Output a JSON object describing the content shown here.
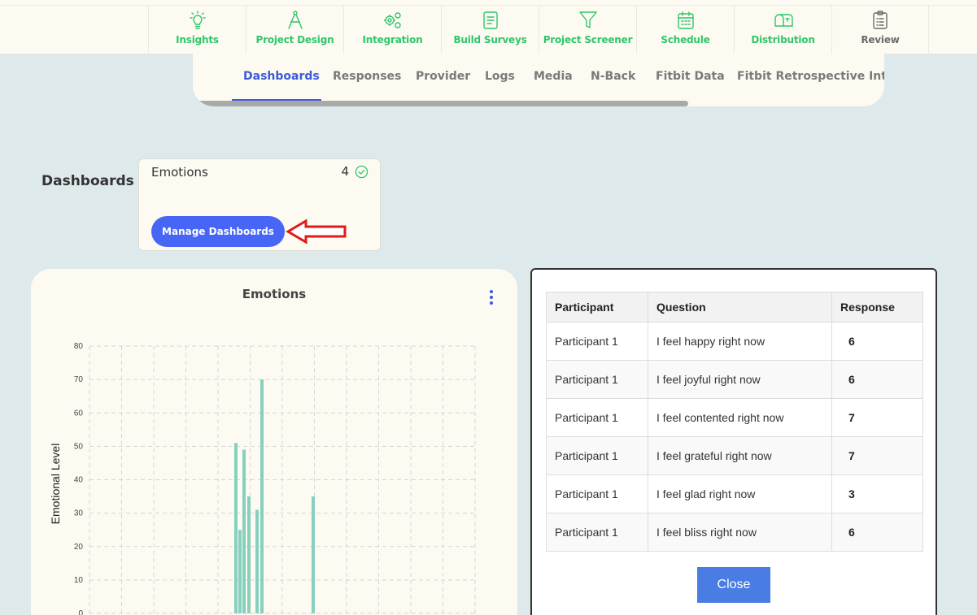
{
  "topnav": {
    "items": [
      {
        "label": "Insights",
        "icon": "lightbulb-icon"
      },
      {
        "label": "Project Design",
        "icon": "compass-icon"
      },
      {
        "label": "Integration",
        "icon": "gears-icon"
      },
      {
        "label": "Build Surveys",
        "icon": "document-icon"
      },
      {
        "label": "Project Screener",
        "icon": "filter-icon"
      },
      {
        "label": "Schedule",
        "icon": "calendar-icon"
      },
      {
        "label": "Distribution",
        "icon": "mailbox-icon"
      },
      {
        "label": "Review",
        "icon": "clipboard-icon"
      }
    ],
    "accent": "#2fc66a"
  },
  "subtabs": {
    "items": [
      "Dashboards",
      "Responses",
      "Provider",
      "Logs",
      "Media",
      "N-Back",
      "Fitbit Data",
      "Fitbit Retrospective Intrad"
    ],
    "active": "Dashboards",
    "accent": "#3b5bdb"
  },
  "dashboards": {
    "label": "Dashboards",
    "card": {
      "name": "Emotions",
      "count": "4",
      "manage_label": "Manage Dashboards"
    }
  },
  "chart": {
    "title": "Emotions"
  },
  "chart_data": {
    "type": "bar",
    "title": "Emotions",
    "ylabel": "Emotional Level",
    "xlabel": "",
    "ylim": [
      0,
      80
    ],
    "yticks": [
      0,
      10,
      20,
      30,
      40,
      50,
      60,
      70,
      80
    ],
    "grid": true,
    "color": "#86d0bd",
    "values": [
      51,
      25,
      49,
      35,
      31,
      70,
      35
    ]
  },
  "table": {
    "headers": [
      "Participant",
      "Question",
      "Response"
    ],
    "rows": [
      [
        "Participant 1",
        "I feel happy right now",
        "6"
      ],
      [
        "Participant 1",
        "I feel joyful right now",
        "6"
      ],
      [
        "Participant 1",
        "I feel contented right now",
        "7"
      ],
      [
        "Participant 1",
        "I feel grateful right now",
        "7"
      ],
      [
        "Participant 1",
        "I feel glad right now",
        "3"
      ],
      [
        "Participant 1",
        "I feel bliss right now",
        "6"
      ]
    ],
    "close_label": "Close"
  }
}
